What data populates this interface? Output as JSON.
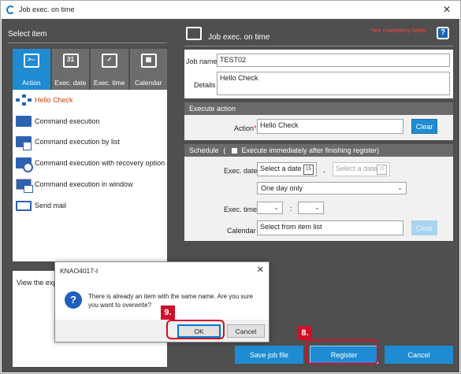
{
  "window": {
    "title": "Job exec. on time"
  },
  "left": {
    "header": "Select item",
    "tabs": [
      {
        "label": "Action",
        "icon": "action-icon",
        "glyph": ">--"
      },
      {
        "label": "Exec. date",
        "icon": "calendar-day-icon",
        "glyph": "31"
      },
      {
        "label": "Exec. time",
        "icon": "clock-check-icon",
        "glyph": "✓"
      },
      {
        "label": "Calendar",
        "icon": "calendar-grid-icon",
        "glyph": "▦"
      }
    ],
    "items": [
      {
        "label": "Hello Check",
        "selected": true
      },
      {
        "label": "Command execution"
      },
      {
        "label": "Command execution by list"
      },
      {
        "label": "Command execution with recovery option"
      },
      {
        "label": "Command execution in window"
      },
      {
        "label": "Send mail"
      }
    ],
    "description": "View the exp"
  },
  "right": {
    "title": "Job exec. on time",
    "mandatory_note": "*are mandatory fields",
    "help": "?",
    "job_name_label": "Job name",
    "job_name_value": "TEST02",
    "details_label": "Details",
    "details_value": "Hello Check",
    "execute_action": {
      "header": "Execute action",
      "action_label": "Action",
      "action_value": "Hello Check",
      "clear_label": "Clear"
    },
    "schedule": {
      "header": "Schedule",
      "paren_open": "(",
      "immediate_label": "Execute immediately after finishing register)",
      "exec_date_label": "Exec. date",
      "date_placeholder": "Select a date",
      "date_dash": "-",
      "date2_placeholder": "Select a date",
      "period_value": "One day only",
      "exec_time_label": "Exec. time",
      "time_sep": ":",
      "calendar_label": "Calendar",
      "calendar_value": "Select from item list",
      "clear_label": "Clear"
    }
  },
  "buttons": {
    "save_job_file": "Save job file",
    "register": "Register",
    "cancel": "Cancel"
  },
  "dialog": {
    "title": "KNAO4017-I",
    "message": "There is already an item with the same name. Are you sure you want to overwrite?",
    "ok": "OK",
    "cancel": "Cancel"
  },
  "callouts": {
    "step_ok": "9.",
    "step_register": "8."
  },
  "colors": {
    "accent": "#1e8bd2",
    "panel_bg": "#4f4f4f",
    "highlight": "#d0102a",
    "selected_text": "#c24a0c",
    "required": "#ff2020"
  }
}
